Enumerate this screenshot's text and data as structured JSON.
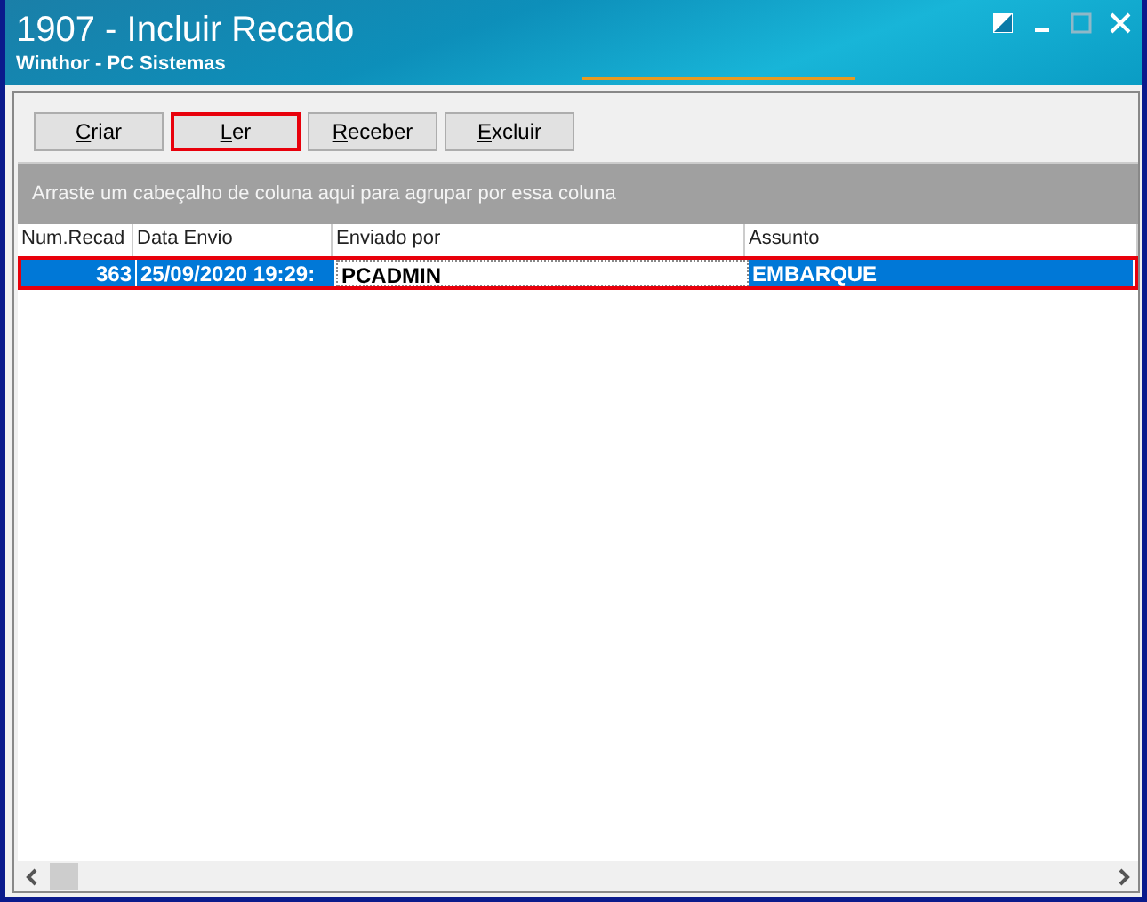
{
  "window": {
    "title": "1907 - Incluir Recado",
    "subtitle": "Winthor - PC Sistemas"
  },
  "toolbar": {
    "buttons": [
      {
        "label": "Criar",
        "highlighted": false
      },
      {
        "label": "Ler",
        "highlighted": true
      },
      {
        "label": "Receber",
        "highlighted": false
      },
      {
        "label": "Excluir",
        "highlighted": false
      }
    ]
  },
  "group_bar": {
    "text": "Arraste um cabeçalho de coluna aqui para agrupar por essa coluna"
  },
  "table": {
    "columns": [
      "Num.Recad",
      "Data Envio",
      "Enviado por",
      "Assunto"
    ],
    "rows": [
      {
        "cells": [
          {
            "text": "363",
            "focused": false
          },
          {
            "text": "25/09/2020 19:29:",
            "focused": false
          },
          {
            "text": "PCADMIN",
            "focused": true
          },
          {
            "text": "EMBARQUE",
            "focused": false
          }
        ],
        "selected": true,
        "highlighted": true
      }
    ]
  }
}
